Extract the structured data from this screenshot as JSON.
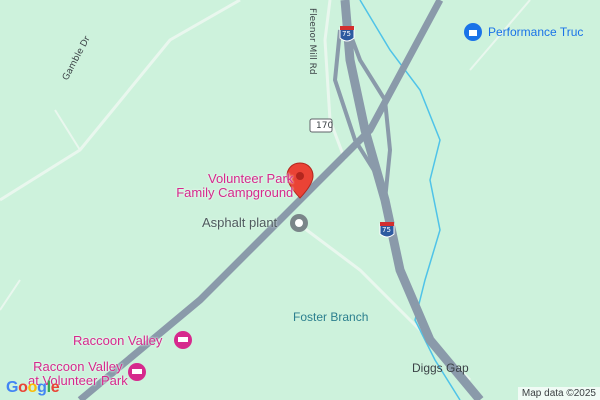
{
  "map": {
    "colors": {
      "land": "#cdf2dc",
      "interstate": "#8a9aaa",
      "highway": "#8a9aaa",
      "minor_road": "#ffffff",
      "stream": "#4fc3e8",
      "hotel_pink": "#d6298d",
      "pin_red": "#ea4335"
    },
    "roads": {
      "gamble": "Gamble Dr",
      "fleenor": "Fleenor Mill Rd",
      "state_route": "170",
      "interstate_top": "75",
      "interstate_mid": "75"
    },
    "pois": {
      "campground": {
        "line1": "Volunteer Park",
        "line2": "Family Campground",
        "icon": "map-pin-icon"
      },
      "asphalt": {
        "label": "Asphalt plant",
        "icon": "industry-dot-icon"
      },
      "raccoon": {
        "label": "Raccoon Valley",
        "icon": "hotel-icon"
      },
      "raccoon_park": {
        "line1": "Raccoon Valley",
        "line2": "at Volunteer Park",
        "icon": "hotel-icon"
      },
      "truck": {
        "label": "Performance Truc",
        "icon": "shopping-bag-icon"
      }
    },
    "places": {
      "foster": "Foster Branch",
      "diggs": "Diggs Gap"
    },
    "footer": {
      "attribution": "Map data ©2025",
      "logo": "Google"
    }
  }
}
